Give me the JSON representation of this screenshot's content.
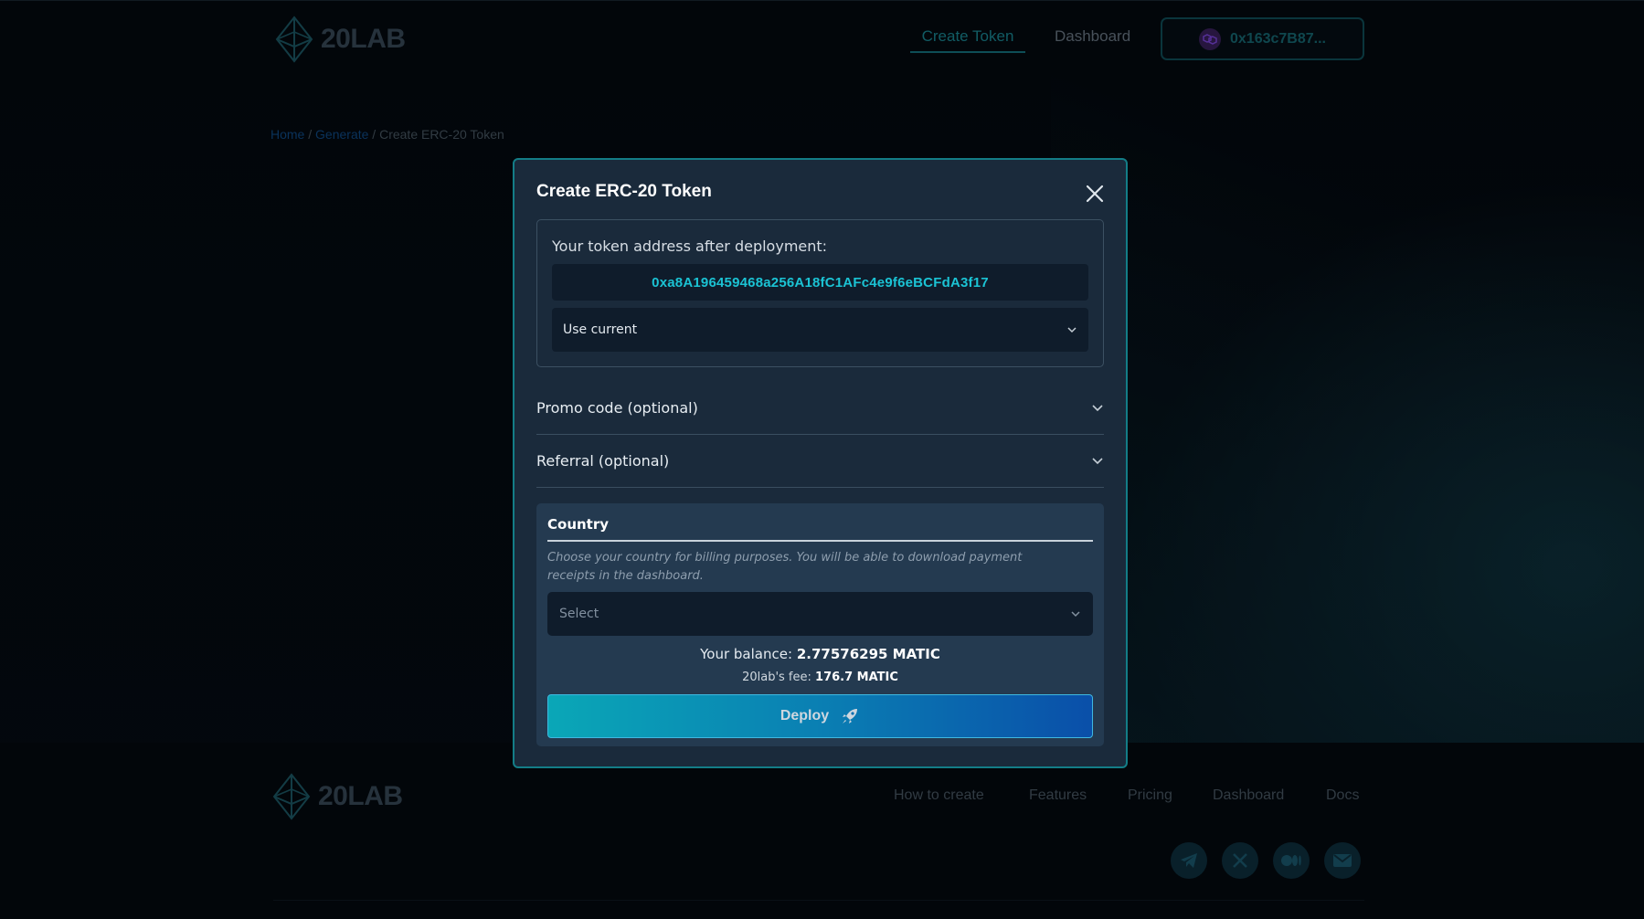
{
  "header": {
    "logo_text": "20LAB",
    "nav": [
      {
        "label": "Create Token",
        "active": true
      },
      {
        "label": "Dashboard",
        "active": false
      }
    ],
    "wallet_address": "0x163c7B87..."
  },
  "breadcrumb": {
    "home": "Home",
    "sep": "/",
    "generate": "Generate",
    "current": "Create ERC-20 Token"
  },
  "modal": {
    "title": "Create ERC-20 Token",
    "address_label": "Your token address after deployment:",
    "address_value": "0xa8A196459468a256A18fC1AFc4e9f6eBCFdA3f17",
    "address_mode": "Use current",
    "promo_label": "Promo code (optional)",
    "referral_label": "Referral (optional)",
    "country": {
      "title": "Country",
      "help": "Choose your country for billing purposes. You will be able to download payment receipts in the dashboard.",
      "placeholder": "Select"
    },
    "balance_label": "Your balance:",
    "balance_value": "2.77576295 MATIC",
    "fee_label": "20lab's fee:",
    "fee_value": "176.7 MATIC",
    "deploy_label": "Deploy"
  },
  "footer": {
    "logo_text": "20LAB",
    "links": [
      "How to create",
      "Features",
      "Pricing",
      "Dashboard",
      "Docs"
    ],
    "social": [
      "telegram-icon",
      "x-icon",
      "medium-icon",
      "mail-icon"
    ]
  },
  "colors": {
    "accent": "#1bc3d4",
    "modal_bg": "#1a2a3b",
    "modal_border": "#137d87",
    "deploy_start": "#0aa7b7",
    "deploy_end": "#0a4fa9"
  }
}
